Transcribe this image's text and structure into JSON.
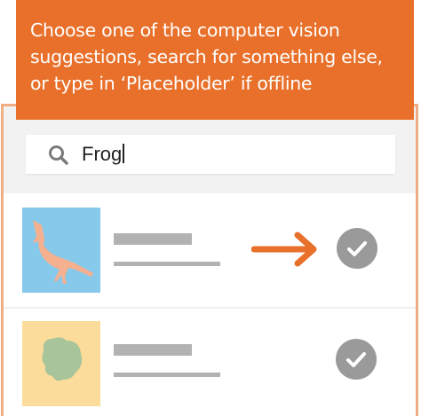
{
  "instruction": {
    "text": "Choose one of the computer vision suggestions, search for something else, or type in ‘Placeholder’ if offline"
  },
  "search": {
    "value": "Frog",
    "icon": "search-icon"
  },
  "suggestions": [
    {
      "thumbnail": "bird-silhouette",
      "thumbnail_bg": "#87c9ea",
      "selected_arrow": true,
      "action_icon": "checkmark-icon"
    },
    {
      "thumbnail": "plant-silhouette",
      "thumbnail_bg": "#fbdc9a",
      "selected_arrow": false,
      "action_icon": "checkmark-icon"
    }
  ],
  "colors": {
    "accent": "#e8702a",
    "panel_border": "#f0ae85",
    "check_bg": "#9a9a9a",
    "placeholder_lines": "#b2b2b2"
  }
}
